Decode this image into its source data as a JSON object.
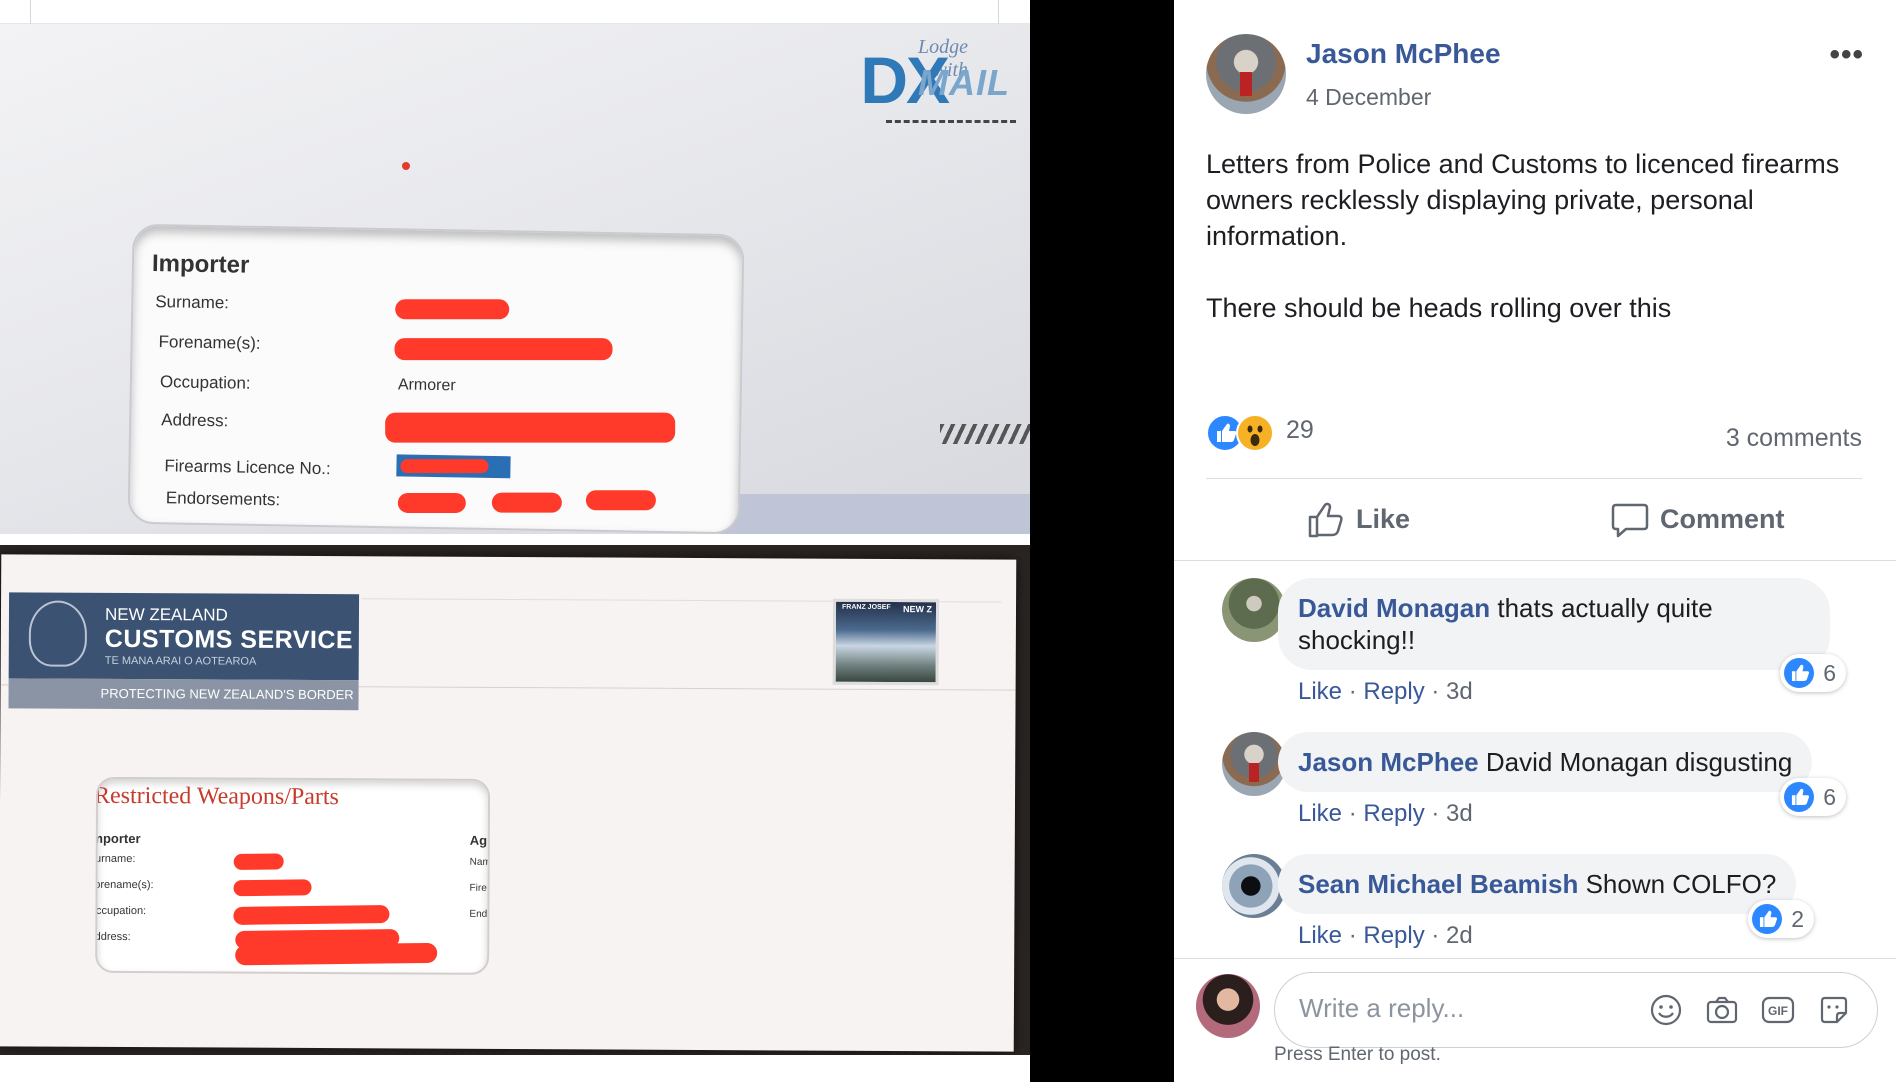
{
  "photo": {
    "top_envelope": {
      "brand_small": "Lodge with",
      "brand_big": "DX",
      "brand_sub": "MAIL",
      "window_title": "Importer",
      "fields": [
        "Surname:",
        "Forename(s):",
        "Occupation:",
        "Address:",
        "Firearms Licence No.:",
        "Endorsements:"
      ],
      "occupation_value": "Armorer"
    },
    "bottom_envelope": {
      "org_line1": "NEW ZEALAND",
      "org_line2": "CUSTOMS SERVICE",
      "org_line3": "TE MANA ARAI O AOTEAROA",
      "tagline": "PROTECTING NEW ZEALAND'S BORDER",
      "window_title": "Restricted Weapons/Parts",
      "window_sub": "Importer",
      "fields": [
        "Surname:",
        "Forename(s):",
        "Occupation:",
        "Address:"
      ],
      "right_tag": "Ag",
      "right_fields": [
        "Nam",
        "Fire",
        "End"
      ],
      "stamp_label": "FRANZ JOSEF",
      "stamp_nz": "NEW Z"
    }
  },
  "post": {
    "author": "Jason McPhee",
    "date": "4 December",
    "paragraphs": [
      "Letters from Police and Customs to licenced firearms owners recklessly displaying private, personal information.",
      "There should be heads rolling over this"
    ],
    "reaction_count": "29",
    "comments_count": "3 comments",
    "like_label": "Like",
    "comment_label": "Comment",
    "more_label": "•••"
  },
  "comments": [
    {
      "author": "David Monagan",
      "text": "thats actually quite shocking!!",
      "like": "Like",
      "reply": "Reply",
      "age": "3d",
      "likes": "6"
    },
    {
      "author": "Jason McPhee",
      "text": "David Monagan disgusting",
      "like": "Like",
      "reply": "Reply",
      "age": "3d",
      "likes": "6"
    },
    {
      "author": "Sean Michael Beamish",
      "text": "Shown COLFO?",
      "like": "Like",
      "reply": "Reply",
      "age": "2d",
      "likes": "2"
    }
  ],
  "reply": {
    "placeholder": "Write a reply...",
    "hint": "Press Enter to post.",
    "gif_label": "GIF"
  },
  "colors": {
    "link": "#385898",
    "like_blue": "#2d88ff",
    "redaction": "#ff3a2a",
    "customs_navy": "#3b5272"
  }
}
